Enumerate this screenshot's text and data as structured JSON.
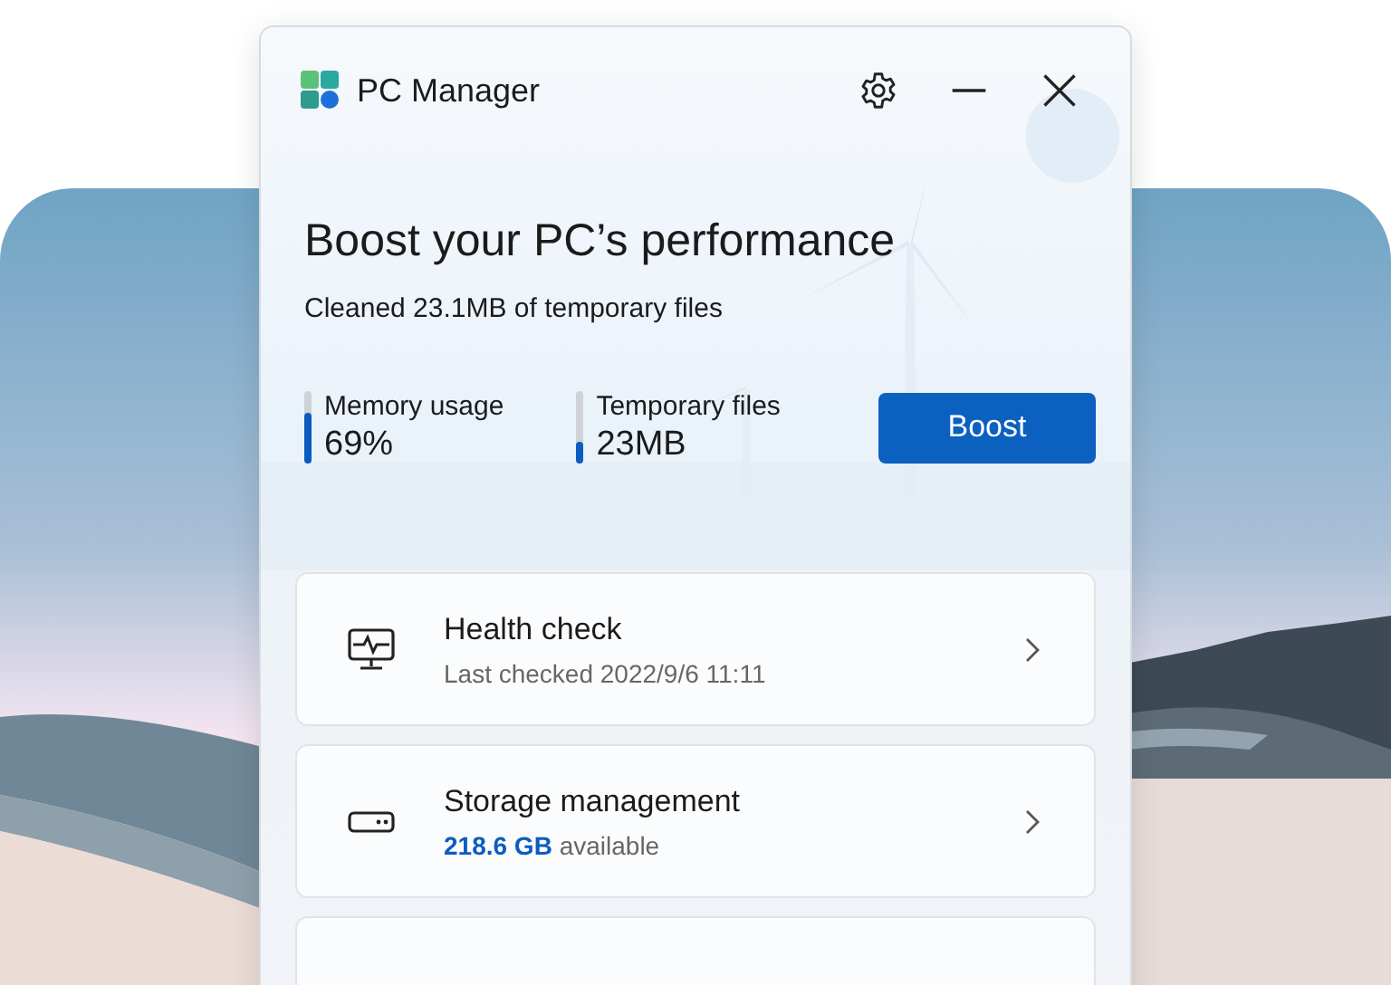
{
  "window": {
    "title": "PC Manager"
  },
  "hero": {
    "title": "Boost your PC’s performance",
    "subtitle": "Cleaned 23.1MB of temporary files"
  },
  "meters": [
    {
      "label": "Memory usage",
      "reading": "69%",
      "level": 0.69
    },
    {
      "label": "Temporary files",
      "reading": "23MB",
      "level": 0.3
    }
  ],
  "boost_button": {
    "label": "Boost"
  },
  "cards": [
    {
      "kind": "health",
      "title": "Health check",
      "subtitle": "Last checked 2022/9/6 11:11"
    },
    {
      "kind": "storage",
      "title": "Storage management",
      "subtitle": "**218.6 GB** available"
    },
    {
      "kind": "blank"
    }
  ]
}
